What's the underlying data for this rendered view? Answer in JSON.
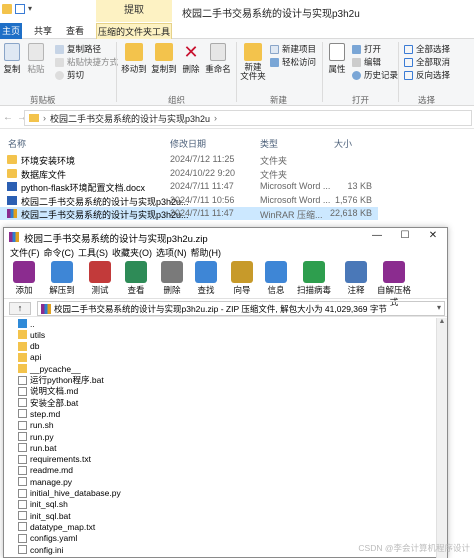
{
  "explorer": {
    "context_tab": "提取",
    "window_title": "校园二手书交易系统的设计与实现p3h2u",
    "ribbon_tabs": [
      "主页",
      "共享",
      "查看",
      "压缩的文件夹工具"
    ],
    "ribbon": {
      "clipboard": {
        "copy": "复制",
        "paste": "粘贴",
        "copy_path": "复制路径",
        "paste_shortcut": "粘贴快捷方式",
        "cut": "剪切",
        "label": "剪贴板"
      },
      "organize": {
        "move_to": "移动到",
        "copy_to": "复制到",
        "delete": "删除",
        "rename": "重命名",
        "label": "组织"
      },
      "new": {
        "new_folder": "新建\n文件夹",
        "new_item": "新建项目",
        "easy_access": "轻松访问",
        "label": "新建"
      },
      "open": {
        "properties": "属性",
        "open": "打开",
        "edit": "编辑",
        "history": "历史记录",
        "label": "打开"
      },
      "select": {
        "select_all": "全部选择",
        "select_none": "全部取消",
        "invert": "反向选择",
        "label": "选择"
      }
    },
    "address": "校园二手书交易系统的设计与实现p3h2u",
    "columns": {
      "name": "名称",
      "date": "修改日期",
      "type": "类型",
      "size": "大小"
    },
    "files": [
      {
        "name": "环境安装环境",
        "date": "2024/7/12 11:25",
        "type": "文件夹",
        "size": "",
        "icon": "folder-icon"
      },
      {
        "name": "数据库文件",
        "date": "2024/10/22 9:20",
        "type": "文件夹",
        "size": "",
        "icon": "folder-icon"
      },
      {
        "name": "python-flask环境配置文档.docx",
        "date": "2024/7/11 11:47",
        "type": "Microsoft Word ...",
        "size": "13 KB",
        "icon": "word-icon"
      },
      {
        "name": "校园二手书交易系统的设计与实现p3h2u...",
        "date": "2024/7/11 10:56",
        "type": "Microsoft Word ...",
        "size": "1,576 KB",
        "icon": "word-icon"
      },
      {
        "name": "校园二手书交易系统的设计与实现p3h2u...",
        "date": "2024/7/11 11:47",
        "type": "WinRAR 压缩...",
        "size": "22,618 KB",
        "icon": "rar-icon"
      }
    ]
  },
  "winrar": {
    "title": "校园二手书交易系统的设计与实现p3h2u.zip",
    "controls": [
      "—",
      "☐",
      "✕"
    ],
    "menu": [
      "文件(F)",
      "命令(C)",
      "工具(S)",
      "收藏夹(O)",
      "选项(N)",
      "帮助(H)"
    ],
    "toolbar": [
      "添加",
      "解压到",
      "测试",
      "查看",
      "删除",
      "查找",
      "向导",
      "信息",
      "扫描病毒",
      "注释",
      "自解压格式"
    ],
    "up_label": "↑",
    "path": "校园二手书交易系统的设计与实现p3h2u.zip - ZIP 压缩文件, 解包大小为 41,029,369 字节",
    "items": [
      {
        "name": "..",
        "icon": "up-folder-icon"
      },
      {
        "name": "utils",
        "icon": "folder-icon"
      },
      {
        "name": "db",
        "icon": "folder-icon"
      },
      {
        "name": "api",
        "icon": "folder-icon"
      },
      {
        "name": "__pycache__",
        "icon": "folder-icon"
      },
      {
        "name": "运行python程序.bat",
        "icon": "file-icon"
      },
      {
        "name": "说明文档.md",
        "icon": "file-icon"
      },
      {
        "name": "安装全部.bat",
        "icon": "file-icon"
      },
      {
        "name": "step.md",
        "icon": "file-icon"
      },
      {
        "name": "run.sh",
        "icon": "file-icon"
      },
      {
        "name": "run.py",
        "icon": "file-icon"
      },
      {
        "name": "run.bat",
        "icon": "file-icon"
      },
      {
        "name": "requirements.txt",
        "icon": "file-icon"
      },
      {
        "name": "readme.md",
        "icon": "file-icon"
      },
      {
        "name": "manage.py",
        "icon": "file-icon"
      },
      {
        "name": "initial_hive_database.py",
        "icon": "file-icon"
      },
      {
        "name": "init_sql.sh",
        "icon": "file-icon"
      },
      {
        "name": "init_sql.bat",
        "icon": "file-icon"
      },
      {
        "name": "datatype_map.txt",
        "icon": "file-icon"
      },
      {
        "name": "configs.yaml",
        "icon": "file-icon"
      },
      {
        "name": "config.ini",
        "icon": "file-icon"
      }
    ]
  },
  "watermark": "CSDN @李会计算机程序设计"
}
